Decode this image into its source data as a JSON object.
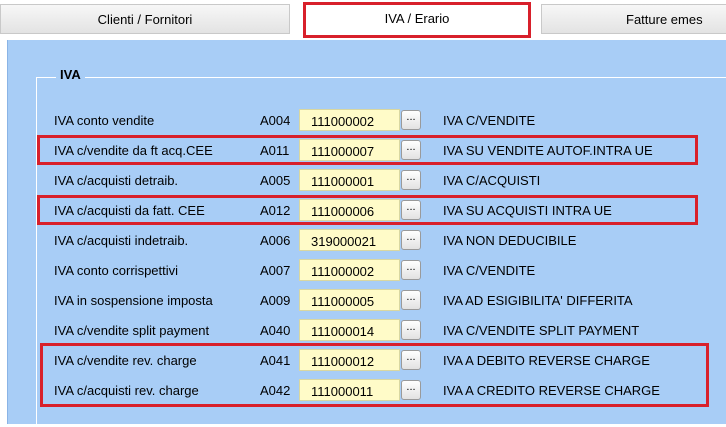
{
  "tabs": [
    {
      "label": "Clienti / Fornitori"
    },
    {
      "label": "IVA / Erario"
    },
    {
      "label": "Fatture emes"
    }
  ],
  "group": {
    "title": "IVA"
  },
  "browse_label": "...",
  "rows": [
    {
      "label": "IVA conto vendite",
      "code": "A004",
      "account": "111000002",
      "description": "IVA C/VENDITE"
    },
    {
      "label": "IVA c/vendite da ft acq.CEE",
      "code": "A011",
      "account": "111000007",
      "description": "IVA SU VENDITE AUTOF.INTRA UE"
    },
    {
      "label": "IVA c/acquisti detraib.",
      "code": "A005",
      "account": "111000001",
      "description": "IVA C/ACQUISTI"
    },
    {
      "label": "IVA c/acquisti da fatt. CEE",
      "code": "A012",
      "account": "111000006",
      "description": "IVA SU ACQUISTI INTRA UE"
    },
    {
      "label": "IVA c/acquisti indetraib.",
      "code": "A006",
      "account": "319000021",
      "description": "IVA NON DEDUCIBILE"
    },
    {
      "label": "IVA conto corrispettivi",
      "code": "A007",
      "account": "111000002",
      "description": "IVA C/VENDITE"
    },
    {
      "label": "IVA in sospensione imposta",
      "code": "A009",
      "account": "111000005",
      "description": "IVA AD ESIGIBILITA' DIFFERITA"
    },
    {
      "label": "IVA c/vendite split payment",
      "code": "A040",
      "account": "111000014",
      "description": "IVA C/VENDITE SPLIT PAYMENT"
    },
    {
      "label": "IVA c/vendite rev. charge",
      "code": "A041",
      "account": "111000012",
      "description": "IVA A DEBITO REVERSE CHARGE"
    },
    {
      "label": "IVA c/acquisti rev. charge",
      "code": "A042",
      "account": "111000011",
      "description": "IVA A CREDITO REVERSE CHARGE"
    }
  ]
}
